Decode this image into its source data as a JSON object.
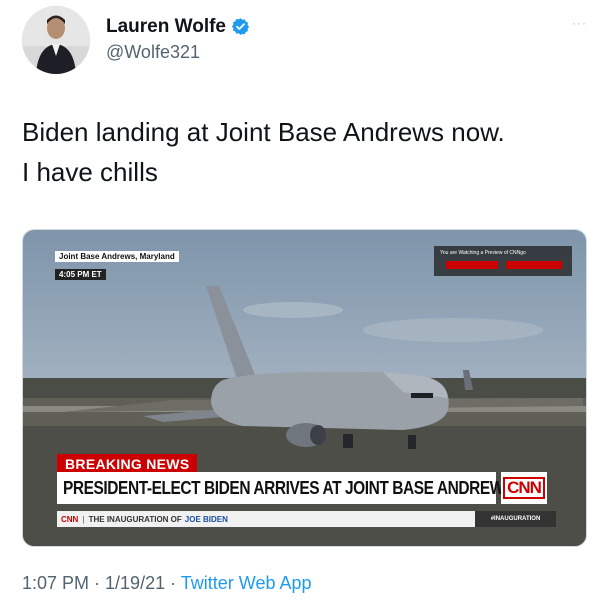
{
  "tweet": {
    "display_name": "Lauren Wolfe",
    "handle": "@Wolfe321",
    "more_label": "···",
    "text_line1": "Biden landing at Joint Base Andrews now.",
    "text_line2": "I have chills",
    "timestamp": "1:07 PM · 1/19/21 · ",
    "source": "Twitter Web App"
  },
  "broadcast": {
    "location": "Joint Base Andrews, Maryland",
    "time": "4:05 PM ET",
    "breaking_label": "BREAKING NEWS",
    "headline": "PRESIDENT-ELECT BIDEN ARRIVES AT JOINT BASE ANDREWS",
    "network": "CNN",
    "ticker_network": "CNN",
    "ticker_text": "THE INAUGURATION OF",
    "ticker_name": "JOE BIDEN",
    "hashtag": "#INAUGURATION",
    "watch_text": "You are Watching a Preview of CNNgo"
  },
  "colors": {
    "verified_blue": "#1d9bf0",
    "cnn_red": "#cc0000",
    "link_blue": "#1d9bf0"
  },
  "icons": {
    "verified": "verified-badge-icon",
    "more": "more-dots-icon"
  }
}
